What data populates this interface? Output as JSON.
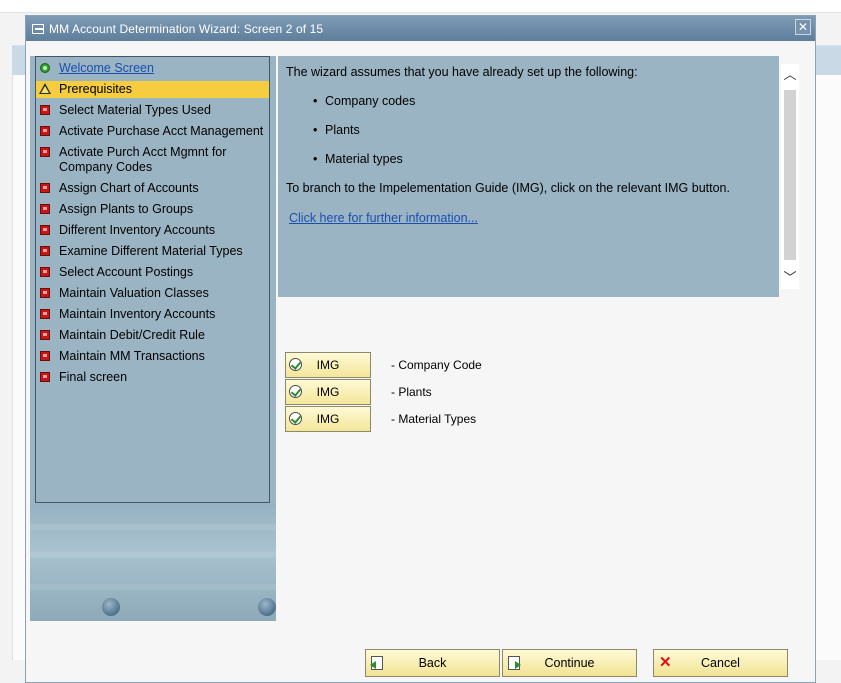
{
  "window": {
    "title": "MM Account Determination Wizard: Screen 2 of 15",
    "close_glyph": "✕"
  },
  "nav": {
    "items": [
      {
        "label": "Welcome Screen",
        "icon": "green-status-icon",
        "state": "link"
      },
      {
        "label": "Prerequisites",
        "icon": "warning-icon",
        "state": "active"
      },
      {
        "label": "Select Material Types Used",
        "icon": "red-status-icon",
        "state": "normal"
      },
      {
        "label": "Activate Purchase Acct Management",
        "icon": "red-status-icon",
        "state": "normal"
      },
      {
        "label": "Activate Purch Acct Mgmnt for Company Codes",
        "icon": "red-status-icon",
        "state": "normal"
      },
      {
        "label": "Assign Chart of Accounts",
        "icon": "red-status-icon",
        "state": "normal"
      },
      {
        "label": "Assign Plants to Groups",
        "icon": "red-status-icon",
        "state": "normal"
      },
      {
        "label": "Different Inventory Accounts",
        "icon": "red-status-icon",
        "state": "normal"
      },
      {
        "label": "Examine Different Material Types",
        "icon": "red-status-icon",
        "state": "normal"
      },
      {
        "label": "Select Account Postings",
        "icon": "red-status-icon",
        "state": "normal"
      },
      {
        "label": "Maintain Valuation Classes",
        "icon": "red-status-icon",
        "state": "normal"
      },
      {
        "label": "Maintain Inventory Accounts",
        "icon": "red-status-icon",
        "state": "normal"
      },
      {
        "label": "Maintain Debit/Credit Rule",
        "icon": "red-status-icon",
        "state": "normal"
      },
      {
        "label": "Maintain MM Transactions",
        "icon": "red-status-icon",
        "state": "normal"
      },
      {
        "label": "Final screen",
        "icon": "red-status-icon",
        "state": "normal"
      }
    ]
  },
  "info": {
    "intro": "The wizard assumes that you have already set up the following:",
    "bullets": [
      "Company codes",
      "Plants",
      "Material types"
    ],
    "branch_text": "To branch to the Impelementation Guide (IMG), click on the relevant IMG button.",
    "link_text": "Click here for further information...",
    "scroll_up": "︿",
    "scroll_down": "﹀"
  },
  "img_buttons": [
    {
      "label": "IMG",
      "desc": "- Company Code"
    },
    {
      "label": "IMG",
      "desc": "- Plants"
    },
    {
      "label": "IMG",
      "desc": "- Material Types"
    }
  ],
  "footer": {
    "back_label": "Back",
    "continue_label": "Continue",
    "cancel_label": "Cancel",
    "cancel_glyph": "✕"
  },
  "colors": {
    "panel": "#9bb4c3",
    "active_item": "#f5cd3f",
    "link": "#1a4fb0",
    "button": "#f6ebac"
  }
}
